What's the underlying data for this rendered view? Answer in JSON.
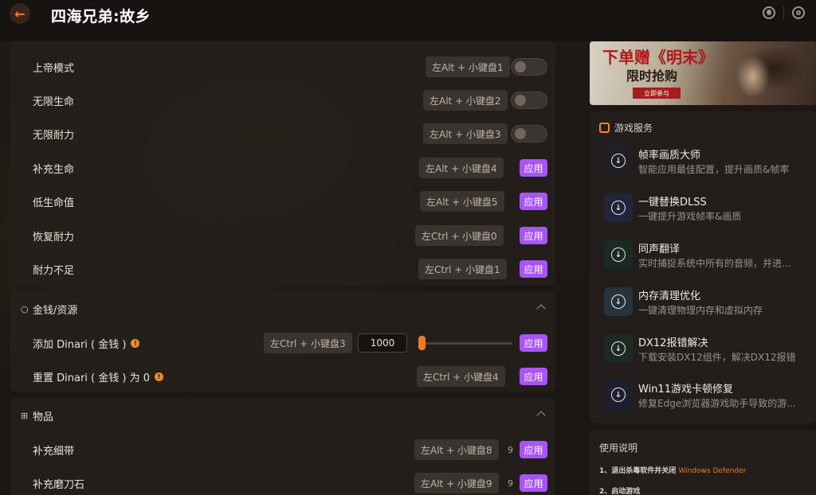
{
  "header": {
    "title": "四海兄弟:故乡",
    "back_icon": "arrow-left-icon",
    "user_icon": "user-icon",
    "settings_icon": "gear-icon"
  },
  "cheats": {
    "items": [
      {
        "label": "上帝模式",
        "hotkey": "左Alt + 小键盘1",
        "control": "toggle"
      },
      {
        "label": "无限生命",
        "hotkey": "左Alt + 小键盘2",
        "control": "toggle"
      },
      {
        "label": "无限耐力",
        "hotkey": "左Alt + 小键盘3",
        "control": "toggle"
      },
      {
        "label": "补充生命",
        "hotkey": "左Alt + 小键盘4",
        "control": "apply"
      },
      {
        "label": "低生命值",
        "hotkey": "左Alt + 小键盘5",
        "control": "apply"
      },
      {
        "label": "恢复耐力",
        "hotkey": "左Ctrl + 小键盘0",
        "control": "apply"
      },
      {
        "label": "耐力不足",
        "hotkey": "左Ctrl + 小键盘1",
        "control": "apply"
      }
    ]
  },
  "money": {
    "title": "金钱/资源",
    "add_label": "添加 Dinari ( 金钱 )",
    "add_hotkey": "左Ctrl + 小键盘3",
    "add_value": "1000",
    "slider_fraction": 0.0,
    "reset_label": "重置 Dinari ( 金钱 ) 为 0",
    "reset_hotkey": "左Ctrl + 小键盘4"
  },
  "items_section": {
    "title": "物品",
    "rows": [
      {
        "label": "补充细带",
        "hotkey": "左Alt + 小键盘8",
        "count": "9"
      },
      {
        "label": "补充磨刀石",
        "hotkey": "左Alt + 小键盘9",
        "count": "9"
      }
    ]
  },
  "apply_label": "应用",
  "banner": {
    "line1": "下单赠《明末》",
    "line2": "限时抢购",
    "button": "立即参与"
  },
  "services": {
    "title": "游戏服务",
    "items": [
      {
        "name": "帧率画质大师",
        "desc": "智能应用最佳配置，提升画质&帧率",
        "bg": "#1f1f24"
      },
      {
        "name": "一键替换DLSS",
        "desc": "一键提升游戏帧率&画质",
        "bg": "#23233a"
      },
      {
        "name": "同声翻译",
        "desc": "实时捕捉系统中所有的音频，并进...",
        "bg": "#1a2a22"
      },
      {
        "name": "内存清理优化",
        "desc": "一键清理物理内存和虚拟内存",
        "bg": "#26333a"
      },
      {
        "name": "DX12报错解决",
        "desc": "下载安装DX12组件，解决DX12报错",
        "bg": "#1d2a24"
      },
      {
        "name": "Win11游戏卡顿修复",
        "desc": "修复Edge浏览器游戏助手导致的游...",
        "bg": "#1e1f2e"
      }
    ]
  },
  "usage": {
    "title": "使用说明",
    "step1": "1、退出杀毒软件并关闭",
    "step1_hl": "Windows Defender",
    "step2": "2、启动游戏"
  },
  "colors": {
    "accent": "#a855f7",
    "orange": "#f07a22"
  }
}
